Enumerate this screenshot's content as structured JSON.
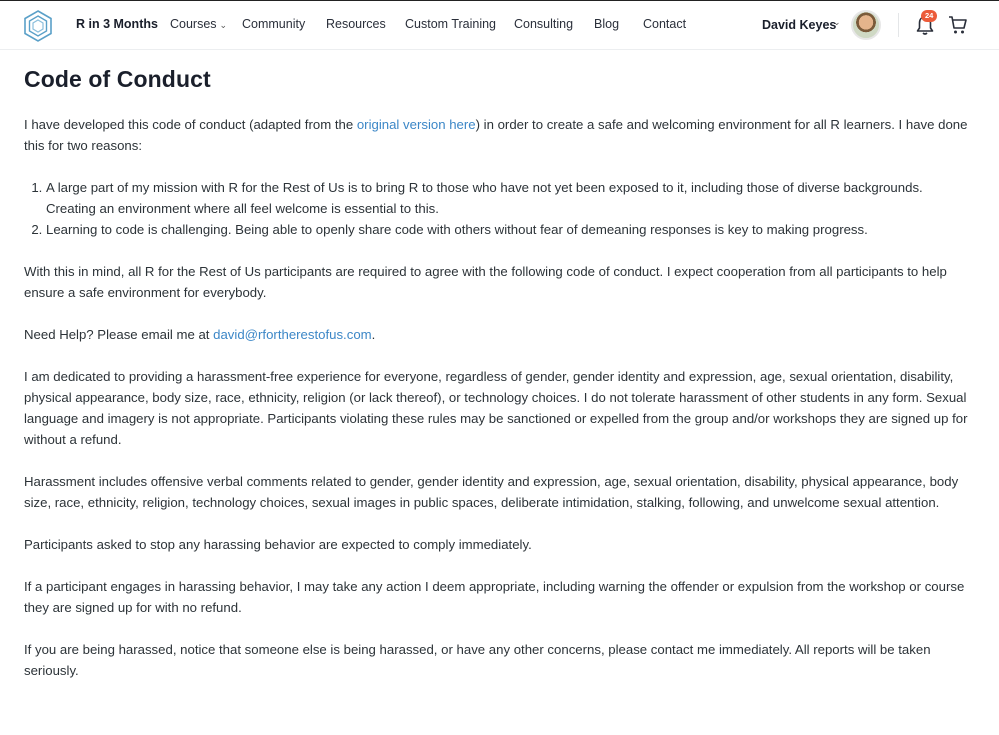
{
  "header": {
    "site_title": "R in 3 Months",
    "nav": {
      "courses": "Courses",
      "community": "Community",
      "resources": "Resources",
      "custom_training": "Custom Training",
      "consulting": "Consulting",
      "blog": "Blog",
      "contact": "Contact"
    },
    "user_name": "David Keyes",
    "notification_count": "24"
  },
  "page": {
    "title": "Code of Conduct",
    "intro_before_link": "I have developed this code of conduct (adapted from the ",
    "intro_link": "original version here",
    "intro_after_link": ") in order to create a safe and welcoming environment for all R learners. I have done this for two reasons:",
    "reasons": [
      "A large part of my mission with R for the Rest of Us is to bring R to those who have not yet been exposed to it, including those of diverse backgrounds. Creating an environment where all feel welcome is essential to this.",
      "Learning to code is challenging. Being able to openly share code with others without fear of demeaning responses is key to making progress."
    ],
    "p_agreement": "With this in mind, all R for the Rest of Us participants are required to agree with the following code of conduct. I expect cooperation from all participants to help ensure a safe environment for everybody.",
    "help_before": "Need Help? Please email me at ",
    "help_email": "david@rfortherestofus.com",
    "help_after": ".",
    "p_dedicated": "I am dedicated to providing a harassment-free experience for everyone, regardless of gender, gender identity and expression, age, sexual orientation, disability, physical appearance, body size, race, ethnicity, religion (or lack thereof), or technology choices. I do not tolerate harassment of other students in any form. Sexual language and imagery is not appropriate. Participants violating these rules may be sanctioned or expelled from the group and/or workshops they are signed up for without a refund.",
    "p_harassment": "Harassment includes offensive verbal comments related to gender, gender identity and expression, age, sexual orientation, disability, physical appearance, body size, race, ethnicity, religion, technology choices, sexual images in public spaces, deliberate intimidation, stalking, following, and unwelcome sexual attention.",
    "p_stop": "Participants asked to stop any harassing behavior are expected to comply immediately.",
    "p_action": "If a participant engages in harassing behavior, I may take any action I deem appropriate, including warning the offender or expulsion from the workshop or course they are signed up for with no refund.",
    "p_report": "If you are being harassed, notice that someone else is being harassed, or have any other concerns, please contact me immediately. All reports will be taken seriously."
  },
  "colors": {
    "link": "#3c87c7",
    "badge": "#ec5b3a",
    "logo": "#5aa0c8"
  },
  "icons": {
    "logo": "hexagon-logo-icon",
    "dropdown": "chevron-down-icon",
    "notifications": "bell-icon",
    "cart": "cart-icon"
  }
}
